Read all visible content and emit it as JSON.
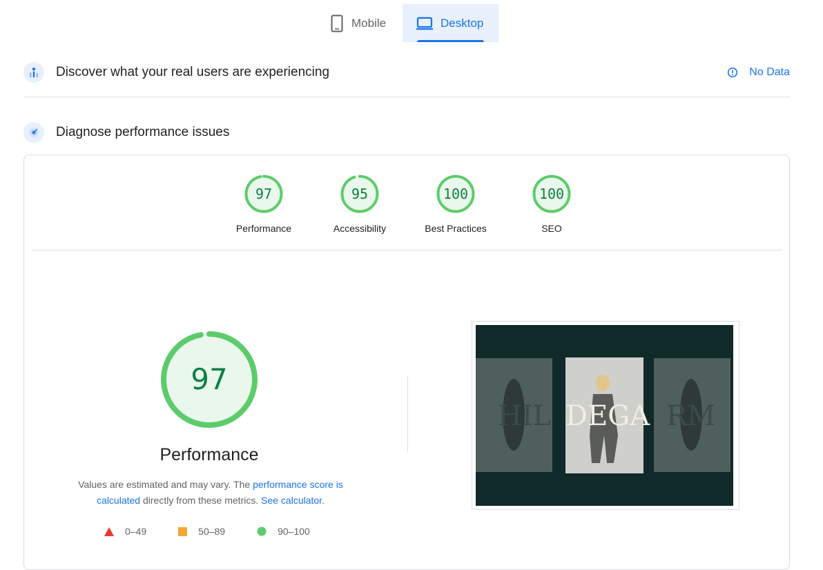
{
  "tabs": [
    {
      "label": "Mobile",
      "icon": "phone-icon",
      "selected": false
    },
    {
      "label": "Desktop",
      "icon": "laptop-icon",
      "selected": true
    }
  ],
  "field_data": {
    "title": "Discover what your real users are experiencing",
    "status_label": "No Data",
    "icon": "users-chart-icon"
  },
  "lab_data": {
    "title": "Diagnose performance issues",
    "icon": "radar-icon"
  },
  "scores": [
    {
      "label": "Performance",
      "value": "97",
      "fraction": 0.97
    },
    {
      "label": "Accessibility",
      "value": "95",
      "fraction": 0.95
    },
    {
      "label": "Best Practices",
      "value": "100",
      "fraction": 1.0
    },
    {
      "label": "SEO",
      "value": "100",
      "fraction": 1.0
    }
  ],
  "performance": {
    "score": "97",
    "fraction": 0.97,
    "title": "Performance",
    "desc_prefix": "Values are estimated and may vary. The ",
    "desc_link": "performance score is calculated",
    "desc_middle": " directly from these metrics. ",
    "desc_link2": "See calculator",
    "desc_end": "."
  },
  "legend": [
    {
      "range": "0–49",
      "shape": "triangle",
      "color": "#e53935"
    },
    {
      "range": "50–89",
      "shape": "square",
      "color": "#f4a736"
    },
    {
      "range": "90–100",
      "shape": "circle",
      "color": "#5ccc6a"
    }
  ],
  "screenshot": {
    "overlay_text": "DEGA",
    "faded_text_left": "HIL",
    "faded_text_right": "RM"
  },
  "colors": {
    "accent": "#1a73e8",
    "pass": "#5ccc6a",
    "pass_fill": "#eaf7ec",
    "pass_text": "#0b8043"
  }
}
